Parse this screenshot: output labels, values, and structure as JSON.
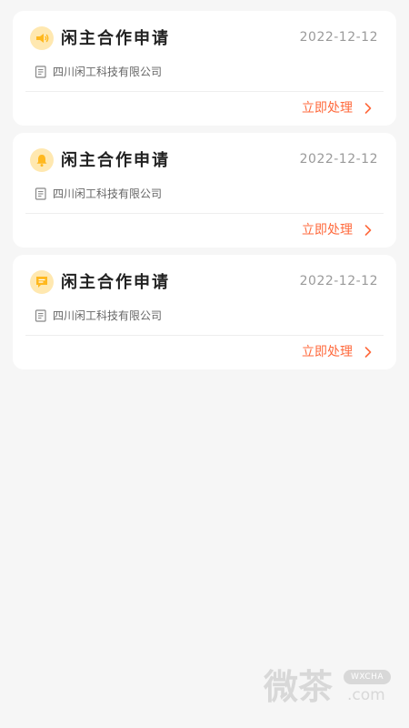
{
  "cards": [
    {
      "icon": "megaphone-icon",
      "title": "闲主合作申请",
      "date": "2022-12-12",
      "company": "四川闲工科技有限公司",
      "action": "立即处理"
    },
    {
      "icon": "bell-icon",
      "title": "闲主合作申请",
      "date": "2022-12-12",
      "company": "四川闲工科技有限公司",
      "action": "立即处理"
    },
    {
      "icon": "message-icon",
      "title": "闲主合作申请",
      "date": "2022-12-12",
      "company": "四川闲工科技有限公司",
      "action": "立即处理"
    }
  ],
  "colors": {
    "accent": "#ff6a3d",
    "icon_bg": "#ffe8b0",
    "icon_fg": "#ffb81e",
    "background": "#f6f6f6"
  },
  "watermark": {
    "text": "微茶",
    "badge": "WXCHA",
    "domain": ".com"
  }
}
